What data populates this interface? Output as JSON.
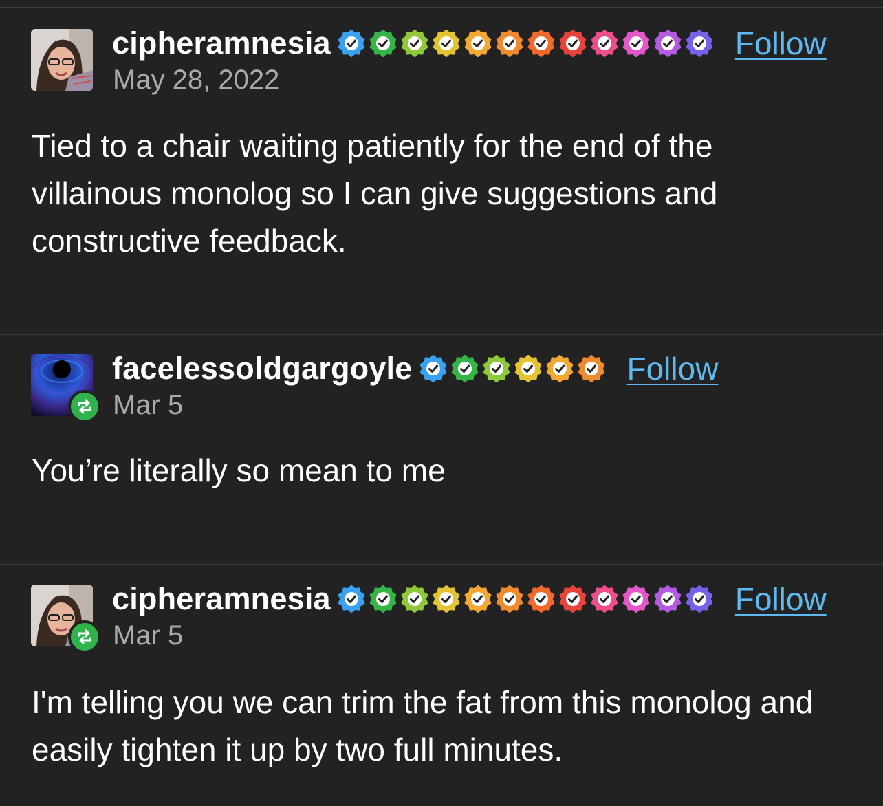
{
  "posts": [
    {
      "username": "cipheramnesia",
      "date": "May 28, 2022",
      "follow_label": "Follow",
      "reblog": false,
      "body": "Tied to a chair waiting patiently for the end of the villainous monolog so I can give suggestions and constructive feedback.",
      "badge_colors": [
        "#3aa0ef",
        "#35b548",
        "#8fc93a",
        "#e3c533",
        "#f3a833",
        "#f08a2e",
        "#f26a2b",
        "#e8433a",
        "#ee4f8c",
        "#e357c9",
        "#b25be0",
        "#7860e8"
      ]
    },
    {
      "username": "facelessoldgargoyle",
      "date": "Mar 5",
      "follow_label": "Follow",
      "reblog": true,
      "body": "You’re literally so mean to me",
      "badge_colors": [
        "#3aa0ef",
        "#35b548",
        "#8fc93a",
        "#e3c533",
        "#f3a833",
        "#f08a2e"
      ]
    },
    {
      "username": "cipheramnesia",
      "date": "Mar 5",
      "follow_label": "Follow",
      "reblog": true,
      "body": "I'm telling you we can trim the fat from this monolog and easily tighten it up by two full minutes.",
      "badge_colors": [
        "#3aa0ef",
        "#35b548",
        "#8fc93a",
        "#e3c533",
        "#f3a833",
        "#f08a2e",
        "#f26a2b",
        "#e8433a",
        "#ee4f8c",
        "#e357c9",
        "#b25be0",
        "#7860e8"
      ]
    }
  ],
  "icons": {
    "badge": "verified-check-badge-icon",
    "reblog": "reblog-icon",
    "avatar_1": "avatar-photo",
    "avatar_2": "avatar-vortex"
  },
  "colors": {
    "background": "#222222",
    "divider": "#3a3a3a",
    "follow_link": "#5fb8f0",
    "date_text": "#a9a9a9",
    "reblog_badge": "#2fb34a"
  }
}
